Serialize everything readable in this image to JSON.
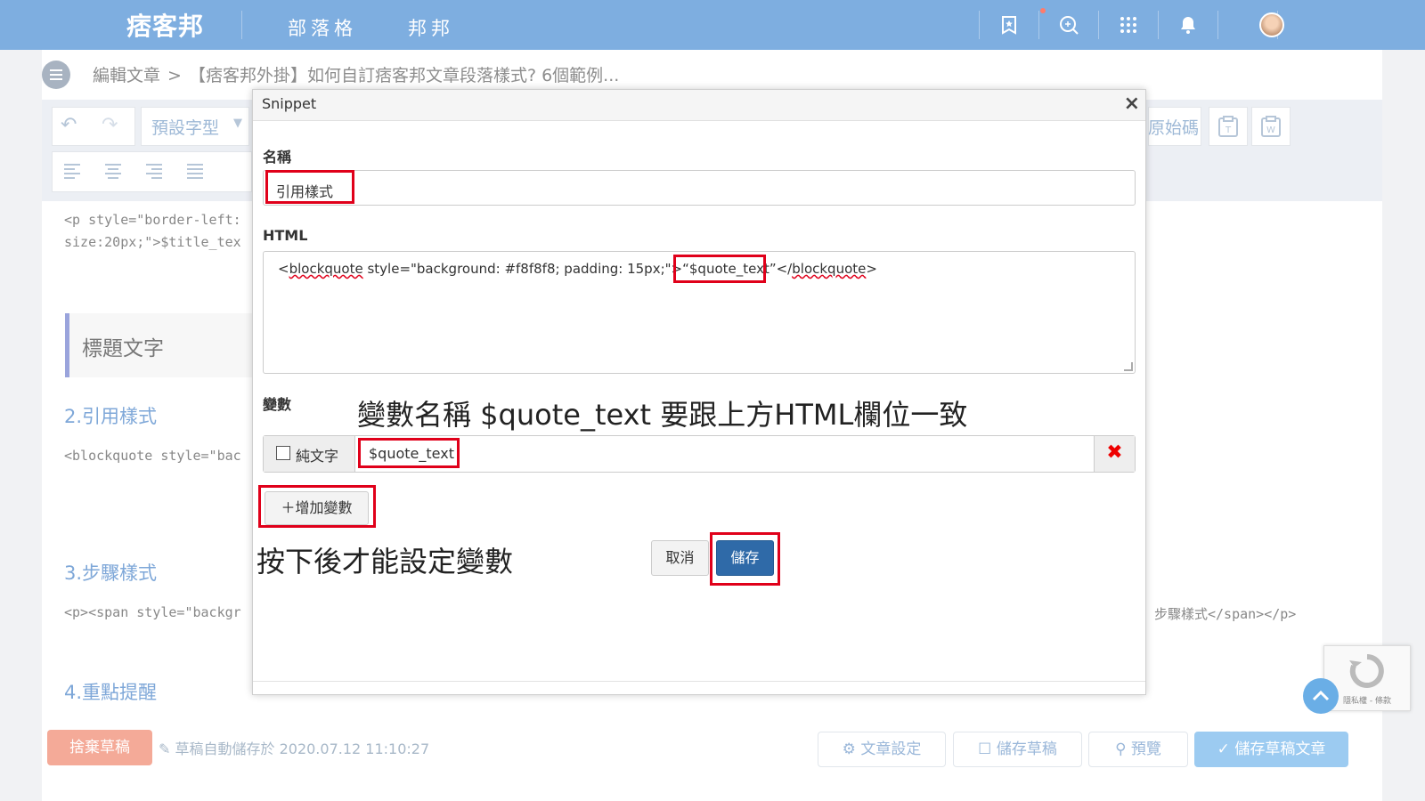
{
  "nav": {
    "logo": "痞客邦",
    "links": [
      "部落格",
      "邦邦"
    ],
    "icons": [
      "bookmark-icon",
      "search-icon",
      "grid-icon",
      "bell-icon",
      "avatar"
    ]
  },
  "breadcrumb": {
    "root": "編輯文章",
    "separator": ">",
    "title": "【痞客邦外掛】如何自訂痞客邦文章段落樣式? 6個範例..."
  },
  "toolbar": {
    "font_select": "預設字型",
    "source_button": "原始碼"
  },
  "editor": {
    "code_line_1": "<p style=\"border-left:",
    "code_line_2": "size:20px;\">$title_tex",
    "title_block": "標題文字",
    "section_2": "2.引用樣式",
    "code_section_2": "<blockquote style=\"bac",
    "section_3": "3.步驟樣式",
    "code_section_3": "<p><span style=\"backgr",
    "code_section_3_end": "步驟樣式</span></p>",
    "section_4": "4.重點提醒"
  },
  "modal": {
    "title": "Snippet",
    "close": "×",
    "name_label": "名稱",
    "name_value": "引用樣式",
    "html_label": "HTML",
    "html_prefix": "<",
    "html_tag_open": "blockquote",
    "html_attr": " style=\"background: #f8f8f8; padding: 15px;\">“",
    "html_var": "$quote_text",
    "html_suffix_1": "”</",
    "html_tag_close": "blockquote",
    "html_suffix_2": ">",
    "vars_label": "變數",
    "var_type_label": "純文字",
    "var_value": "$quote_text",
    "var_delete": "✖",
    "add_var_button": "＋增加變數",
    "cancel_button": "取消",
    "save_button": "儲存"
  },
  "annotations": {
    "var_note": "變數名稱 $quote_text 要跟上方HTML欄位一致",
    "add_note": "按下後才能設定變數"
  },
  "bottom": {
    "discard_button": "捨棄草稿",
    "autosave": "草稿自動儲存於 2020.07.12 11:10:27",
    "settings_button": "文章設定",
    "save_draft_button": "儲存草稿",
    "preview_button": "預覽",
    "publish_button": "儲存草稿文章"
  },
  "recaptcha": {
    "text": "隱私權 - 條款"
  }
}
